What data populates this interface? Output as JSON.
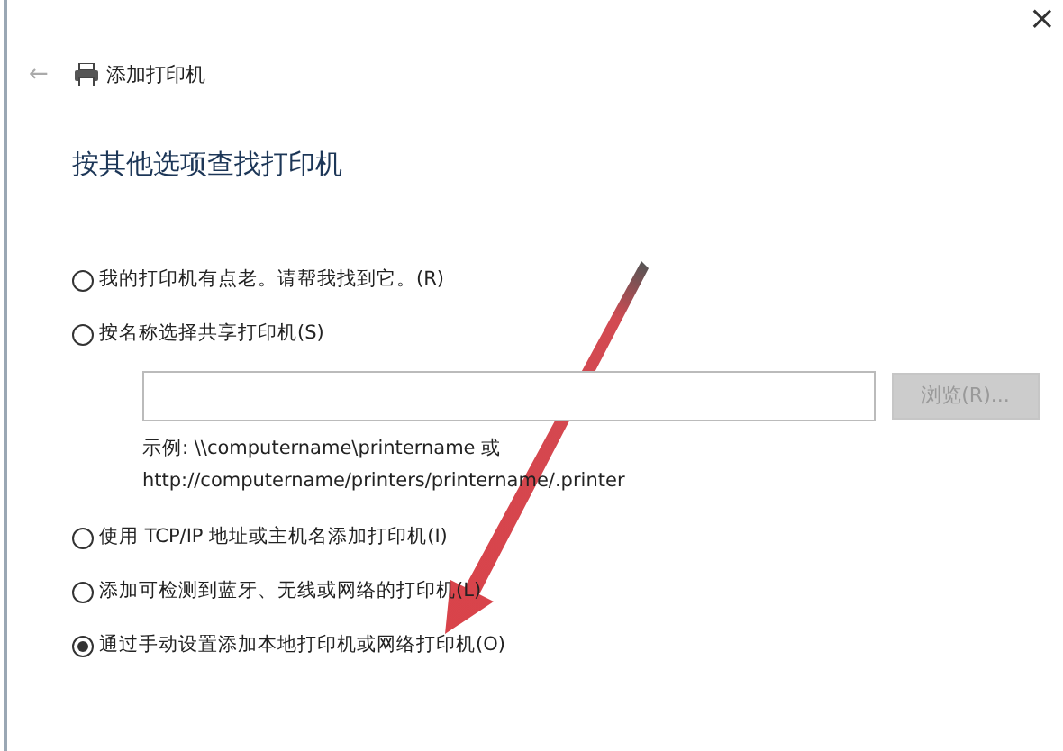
{
  "window": {
    "title": "添加打印机",
    "close": "×",
    "back": "←"
  },
  "heading": "按其他选项查找打印机",
  "options": [
    {
      "label": "我的打印机有点老。请帮我找到它。(R)",
      "selected": false
    },
    {
      "label": "按名称选择共享打印机(S)",
      "selected": false,
      "share": {
        "browse": {
          "label": "浏览(R)...",
          "disabled": true
        },
        "example": [
          "示例: \\\\computername\\printername 或",
          "http://computername/printers/printername/.printer"
        ]
      }
    },
    {
      "label": "使用 TCP/IP 地址或主机名添加打印机(I)",
      "selected": false
    },
    {
      "label": "添加可检测到蓝牙、无线或网络的打印机(L)",
      "selected": false
    },
    {
      "label": "通过手动设置添加本地打印机或网络打印机(O)",
      "selected": true
    }
  ]
}
